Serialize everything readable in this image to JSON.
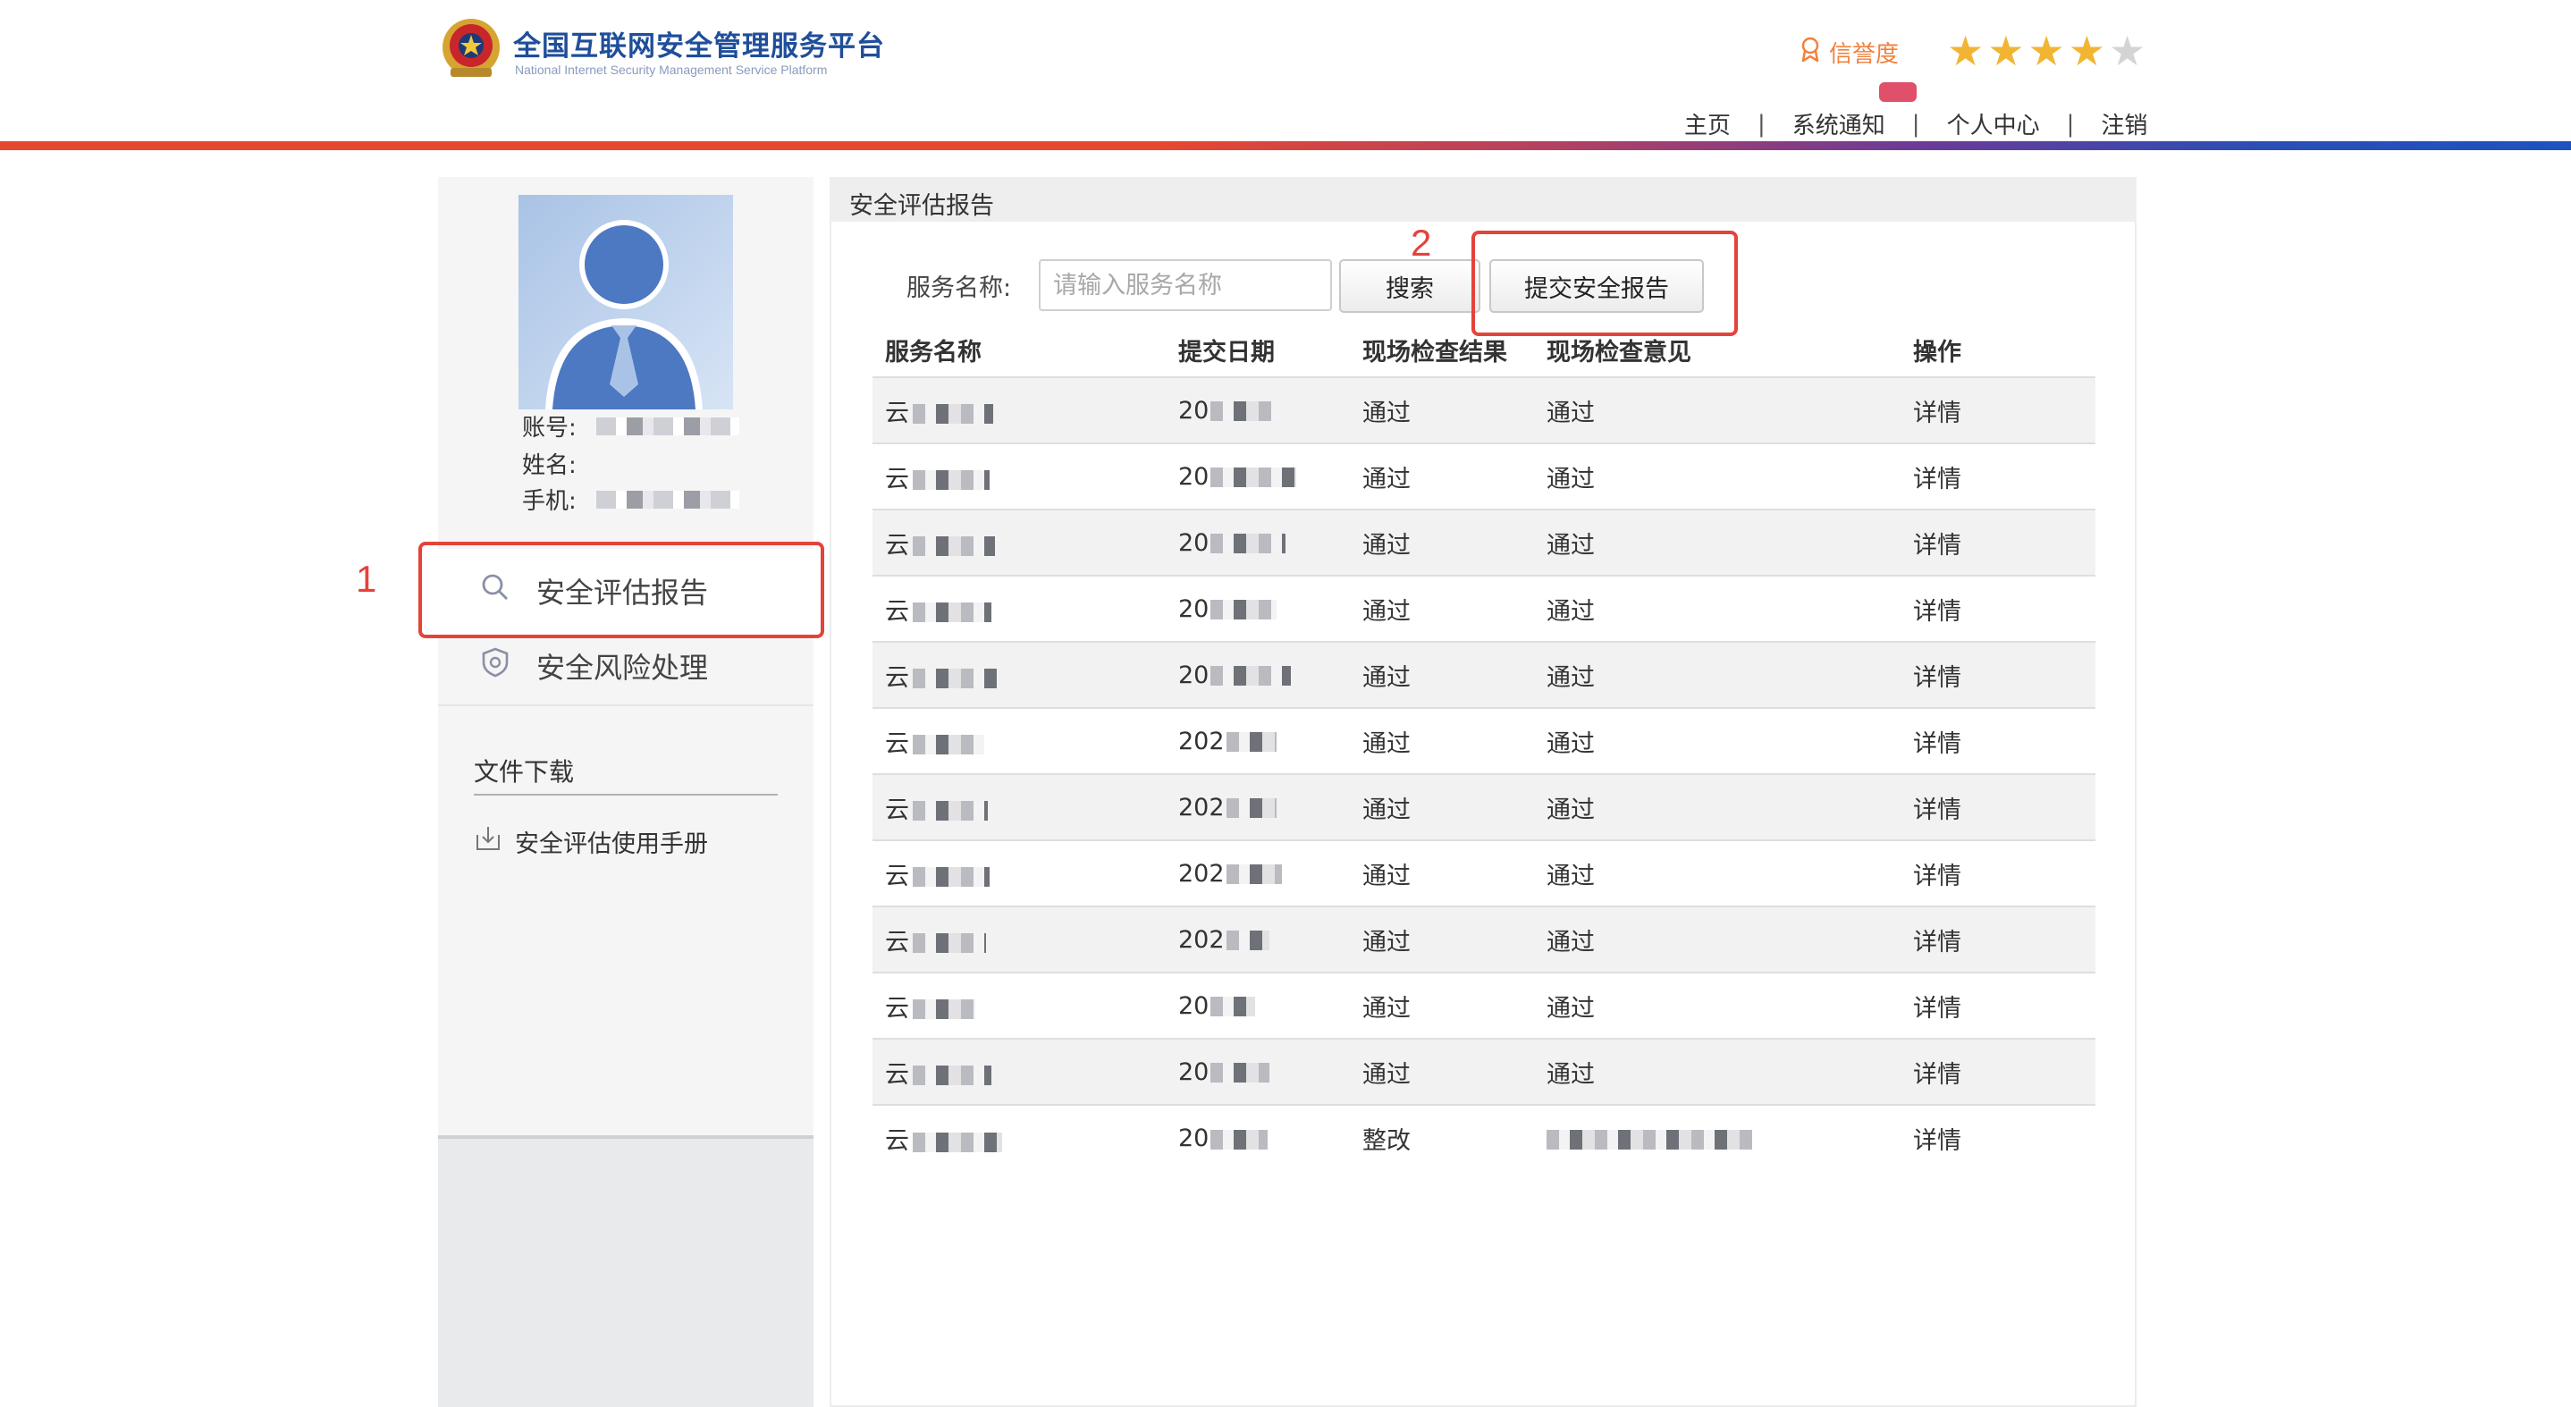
{
  "header": {
    "title": "全国互联网安全管理服务平台",
    "subtitle": "National Internet Security Management Service Platform",
    "credit_label": "信誉度",
    "rating": 4,
    "rating_max": 5,
    "nav": [
      {
        "label": "主页"
      },
      {
        "label": "系统通知"
      },
      {
        "label": "个人中心"
      },
      {
        "label": "注销"
      }
    ],
    "nav_separator": "|"
  },
  "sidebar": {
    "account_label": "账号:",
    "name_label": "姓名:",
    "phone_label": "手机:",
    "menu": [
      {
        "label": "安全评估报告",
        "icon": "search-icon"
      },
      {
        "label": "安全风险处理",
        "icon": "shield-icon"
      }
    ],
    "files_title": "文件下载",
    "files": [
      {
        "label": "安全评估使用手册",
        "icon": "download-icon"
      }
    ]
  },
  "annotations": {
    "box1_number": "1",
    "box2_number": "2"
  },
  "main": {
    "panel_title": "安全评估报告",
    "search_label": "服务名称:",
    "search_placeholder": "请输入服务名称",
    "search_button": "搜索",
    "submit_button": "提交安全报告",
    "columns": [
      "服务名称",
      "提交日期",
      "现场检查结果",
      "现场检查意见",
      "操作"
    ],
    "rows": [
      {
        "name": "云",
        "date": "20",
        "result": "通过",
        "opinion": "通过",
        "action": "详情"
      },
      {
        "name": "云",
        "date": "20",
        "result": "通过",
        "opinion": "通过",
        "action": "详情"
      },
      {
        "name": "云",
        "date": "20",
        "result": "通过",
        "opinion": "通过",
        "action": "详情"
      },
      {
        "name": "云",
        "date": "20",
        "result": "通过",
        "opinion": "通过",
        "action": "详情"
      },
      {
        "name": "云",
        "date": "20",
        "result": "通过",
        "opinion": "通过",
        "action": "详情"
      },
      {
        "name": "云",
        "date": "202",
        "result": "通过",
        "opinion": "通过",
        "action": "详情"
      },
      {
        "name": "云",
        "date": "202",
        "result": "通过",
        "opinion": "通过",
        "action": "详情"
      },
      {
        "name": "云",
        "date": "202",
        "result": "通过",
        "opinion": "通过",
        "action": "详情"
      },
      {
        "name": "云",
        "date": "202",
        "result": "通过",
        "opinion": "通过",
        "action": "详情"
      },
      {
        "name": "云",
        "date": "20",
        "result": "通过",
        "opinion": "通过",
        "action": "详情"
      },
      {
        "name": "云",
        "date": "20",
        "result": "通过",
        "opinion": "通过",
        "action": "详情"
      },
      {
        "name": "云",
        "date": "20",
        "result": "整改",
        "opinion": "",
        "action": "详情"
      }
    ]
  },
  "colors": {
    "brand": "#1f4e9a",
    "accent_red": "#e4433a",
    "credit": "#f0813e",
    "star": "#f2b533"
  }
}
